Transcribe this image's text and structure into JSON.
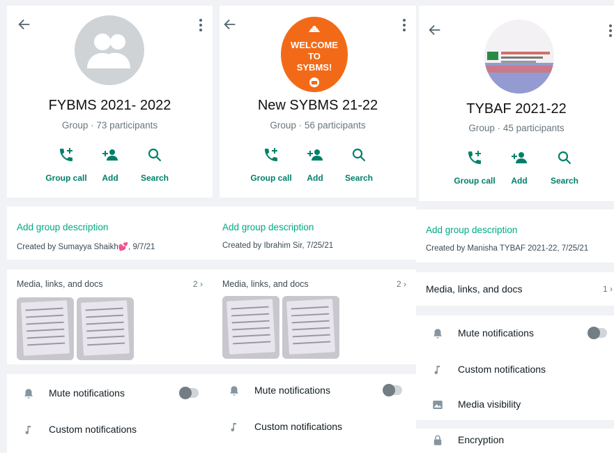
{
  "colors": {
    "accent": "#008069",
    "link": "#00a884",
    "avatar_default": "#cfd3d6",
    "avatar_orange": "#f26a17"
  },
  "panels": [
    {
      "group_name": "FYBMS  2021- 2022",
      "subtitle": "Group · 73 participants",
      "avatar": "default-group-icon",
      "actions": [
        "Group call",
        "Add",
        "Search"
      ],
      "description_label": "Add group description",
      "created_by": "Created by Sumayya Shaikh💕, 9/7/21",
      "media_label": "Media, links, and docs",
      "media_count": "2 ›",
      "settings": [
        "Mute notifications",
        "Custom notifications"
      ]
    },
    {
      "group_name": "New SYBMS 21-22",
      "subtitle": "Group · 56 participants",
      "avatar": "welcome-badge",
      "avatar_text": [
        "WELCOME",
        "TO",
        "SYBMS!"
      ],
      "actions": [
        "Group call",
        "Add",
        "Search"
      ],
      "description_label": "Add group description",
      "created_by": "Created by Ibrahim Sir, 7/25/21",
      "media_label": "Media, links, and docs",
      "media_count": "2 ›",
      "settings": [
        "Mute notifications",
        "Custom notifications"
      ]
    },
    {
      "group_name": "TYBAF 2021-22",
      "subtitle": "Group · 45 participants",
      "avatar": "blurred-photo",
      "actions": [
        "Group call",
        "Add",
        "Search"
      ],
      "description_label": "Add group description",
      "created_by": "Created by Manisha TYBAF 2021-22, 7/25/21",
      "media_label": "Media, links, and docs",
      "media_count": "1 ›",
      "settings": [
        "Mute notifications",
        "Custom notifications",
        "Media visibility",
        "Encryption"
      ]
    }
  ]
}
